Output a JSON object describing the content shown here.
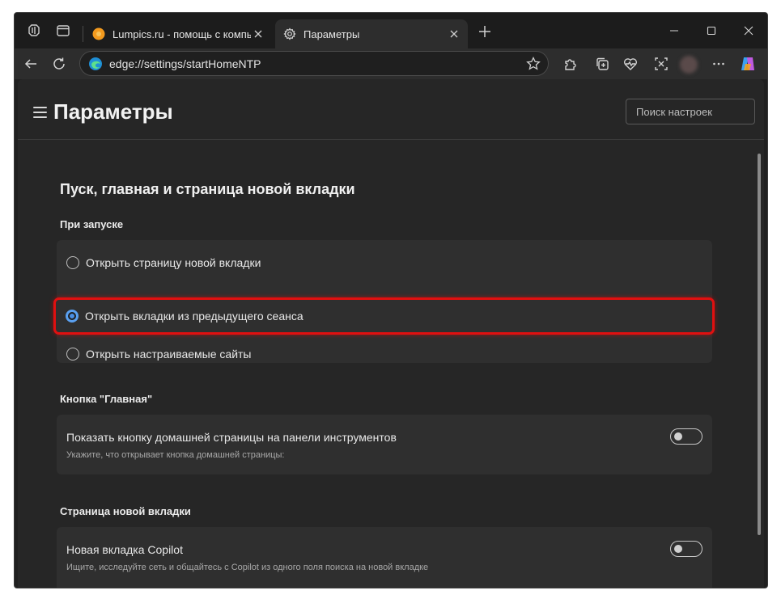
{
  "browser": {
    "tabs": [
      {
        "title": "Lumpics.ru - помощь с компьютером",
        "favicon": "orange-circle-icon",
        "active": false
      },
      {
        "title": "Параметры",
        "favicon": "gear-icon",
        "active": true
      }
    ],
    "address": "edge://settings/startHomeNTP"
  },
  "header": {
    "title": "Параметры",
    "search_placeholder": "Поиск настроек"
  },
  "main": {
    "section_title": "Пуск, главная и страница новой вкладки",
    "startup": {
      "title": "При запуске",
      "options": [
        {
          "label": "Открыть страницу новой вкладки",
          "checked": false
        },
        {
          "label": "Открыть вкладки из предыдущего сеанса",
          "checked": true
        },
        {
          "label": "Открыть настраиваемые сайты",
          "checked": false
        }
      ]
    },
    "home_button": {
      "title": "Кнопка \"Главная\"",
      "setting_title": "Показать кнопку домашней страницы на панели инструментов",
      "setting_desc": "Укажите, что открывает кнопка домашней страницы:",
      "enabled": false
    },
    "new_tab": {
      "title": "Страница новой вкладки",
      "setting_title": "Новая вкладка Copilot",
      "setting_desc": "Ищите, исследуйте сеть и общайтесь с Copilot из одного поля поиска на новой вкладке",
      "enabled": false
    }
  },
  "colors": {
    "accent": "#4a8fe3",
    "highlight": "#e01010",
    "background": "#262626",
    "card": "#2f2f2f"
  }
}
